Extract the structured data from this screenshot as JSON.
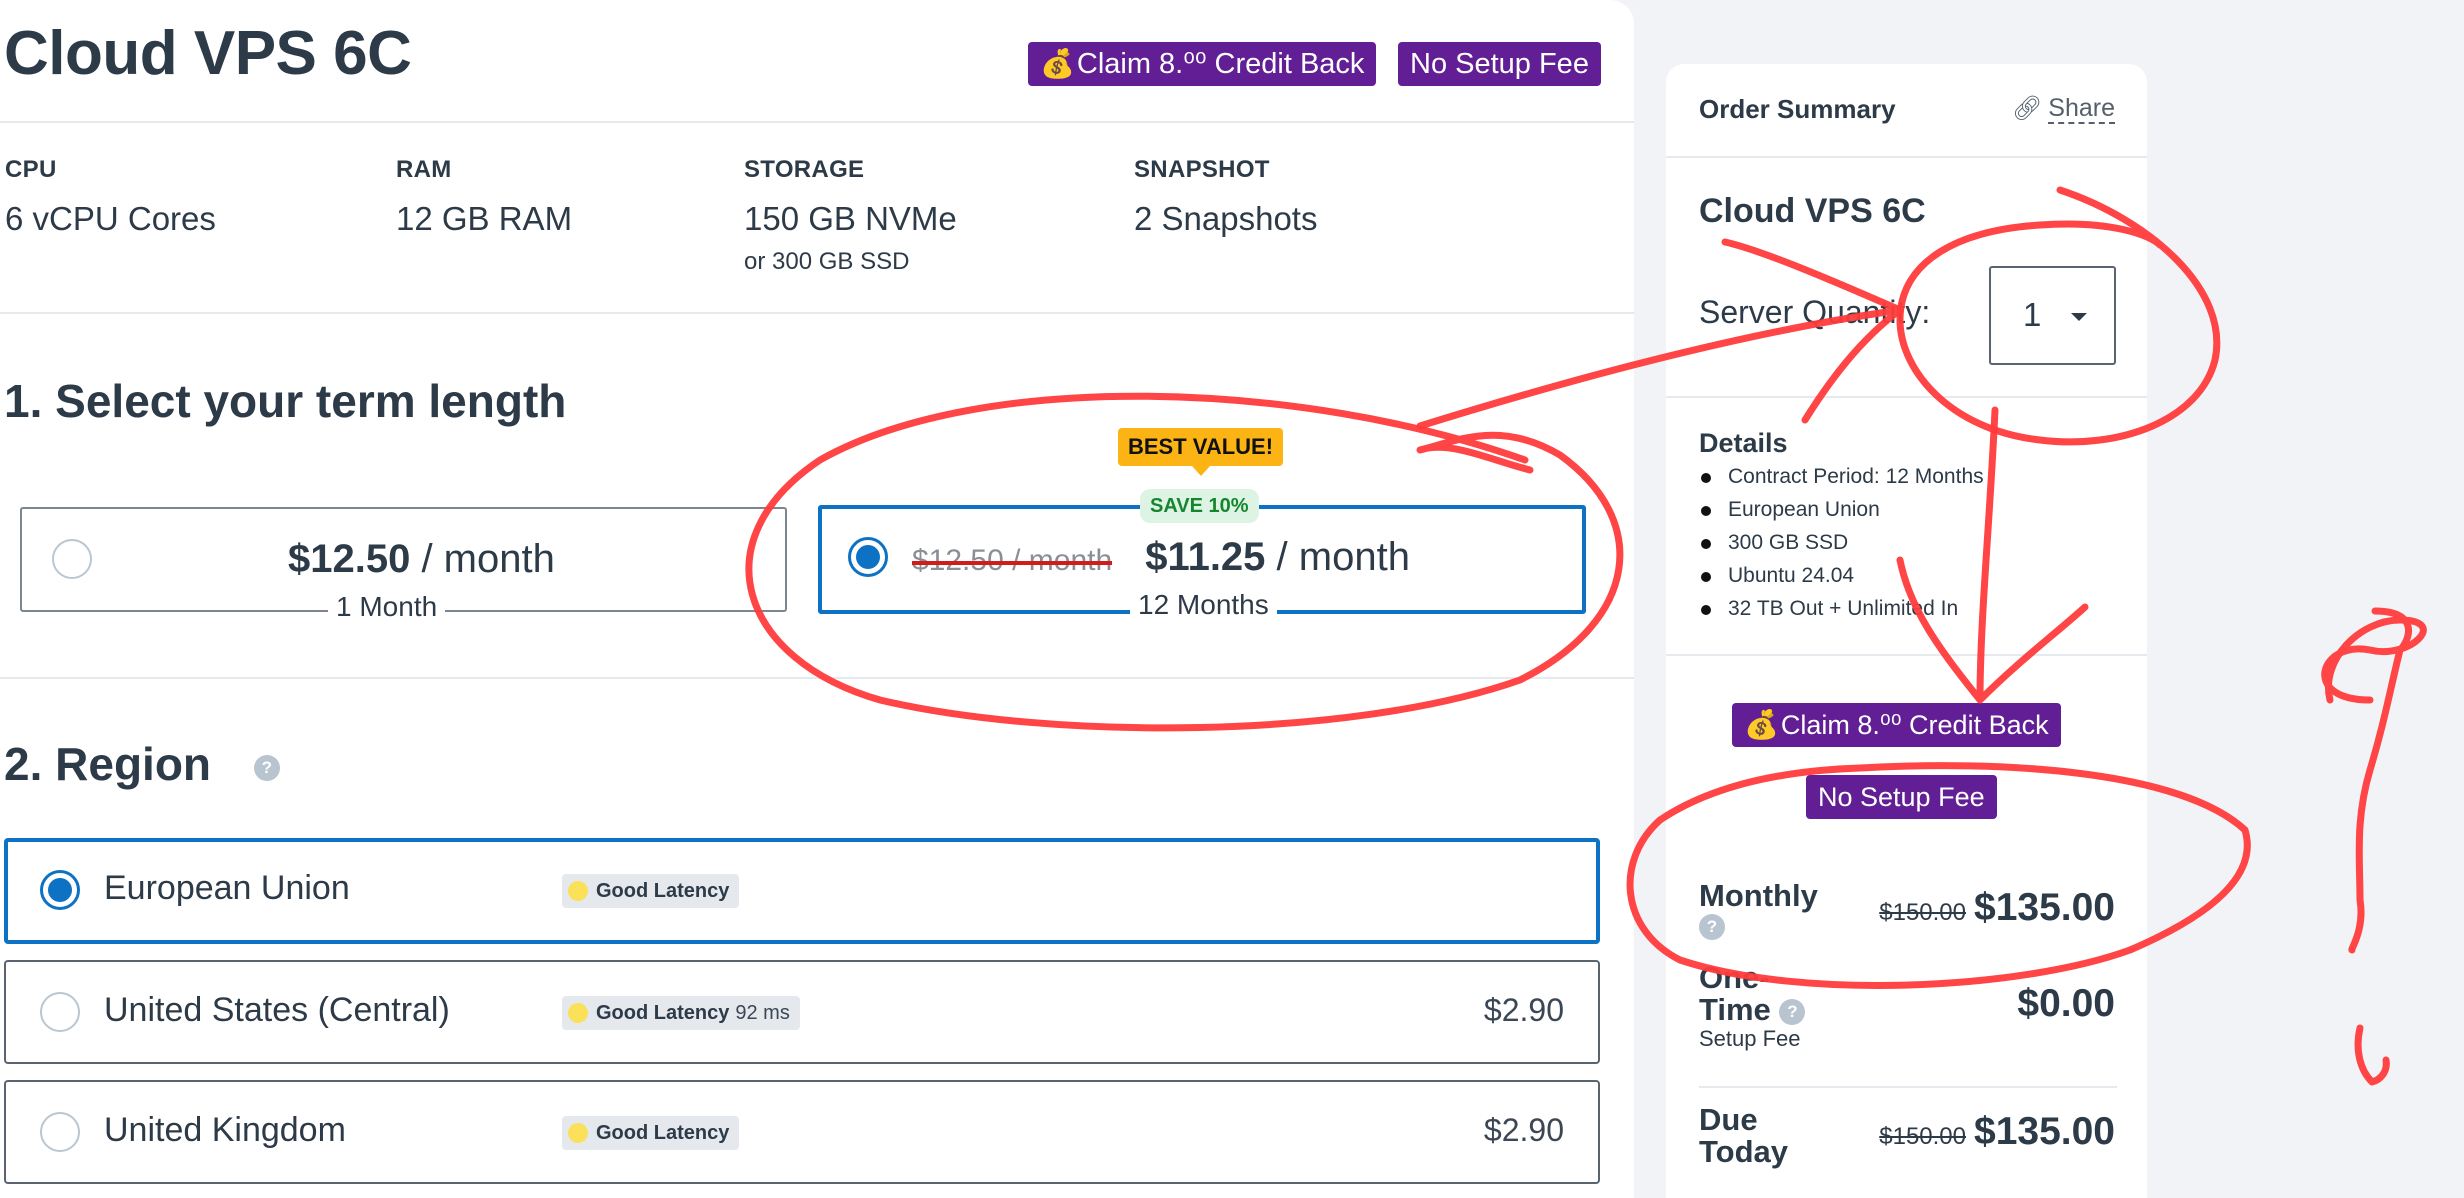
{
  "product": {
    "title": "Cloud VPS 6C",
    "promos": {
      "credit_icon": "money-bag-icon",
      "credit_label": "Claim 8.⁰⁰ Credit Back",
      "setup_label": "No Setup Fee"
    },
    "specs": [
      {
        "label": "CPU",
        "value": "6 vCPU Cores",
        "sub": ""
      },
      {
        "label": "RAM",
        "value": "12 GB RAM",
        "sub": ""
      },
      {
        "label": "STORAGE",
        "value": "150 GB NVMe",
        "sub": "or 300 GB SSD"
      },
      {
        "label": "SNAPSHOT",
        "value": "2 Snapshots",
        "sub": ""
      }
    ]
  },
  "term": {
    "heading": "1. Select your term length",
    "options": [
      {
        "price": "$12.50",
        "unit": " / month",
        "period": "1 Month",
        "selected": false
      },
      {
        "old_price": "$12.50 / month",
        "price": "$11.25",
        "unit": " / month",
        "period": "12 Months",
        "selected": true,
        "tooltip": "BEST VALUE!",
        "save_badge": "SAVE 10%"
      }
    ]
  },
  "region": {
    "heading": "2. Region",
    "help_icon": "question-circle-icon",
    "options": [
      {
        "name": "European Union",
        "latency": "Good Latency",
        "latency_ms": "",
        "price": "",
        "selected": true
      },
      {
        "name": "United States (Central)",
        "latency": "Good Latency",
        "latency_ms": "92 ms",
        "price": "$2.90",
        "selected": false
      },
      {
        "name": "United Kingdom",
        "latency": "Good Latency",
        "latency_ms": "",
        "price": "$2.90",
        "selected": false
      }
    ]
  },
  "summary": {
    "title": "Order Summary",
    "share_icon": "link-icon",
    "share_label": "Share",
    "product": "Cloud VPS 6C",
    "quantity_label": "Server Quantity:",
    "quantity_value": "1",
    "details_heading": "Details",
    "details": [
      "Contract Period: 12 Months",
      "European Union",
      "300 GB SSD",
      "Ubuntu 24.04",
      "32 TB Out + Unlimited In"
    ],
    "promos": {
      "credit_label": "Claim 8.⁰⁰ Credit Back",
      "setup_label": "No Setup Fee"
    },
    "monthly": {
      "label": "Monthly",
      "old": "$150.00",
      "amount": "$135.00"
    },
    "one_time": {
      "label_line1": "One-",
      "label_line2": "Time",
      "sub": "Setup Fee",
      "amount": "$0.00"
    },
    "due_today": {
      "label_line1": "Due",
      "label_line2": "Today",
      "old": "$150.00",
      "amount": "$135.00"
    }
  },
  "colors": {
    "accent_blue": "#0d72c3",
    "promo_purple": "#621f95",
    "best_value_yellow": "#fbb414",
    "save_green": "#16862e",
    "latency_dot": "#fbe05a",
    "annotation_red": "#ff3b3b"
  }
}
